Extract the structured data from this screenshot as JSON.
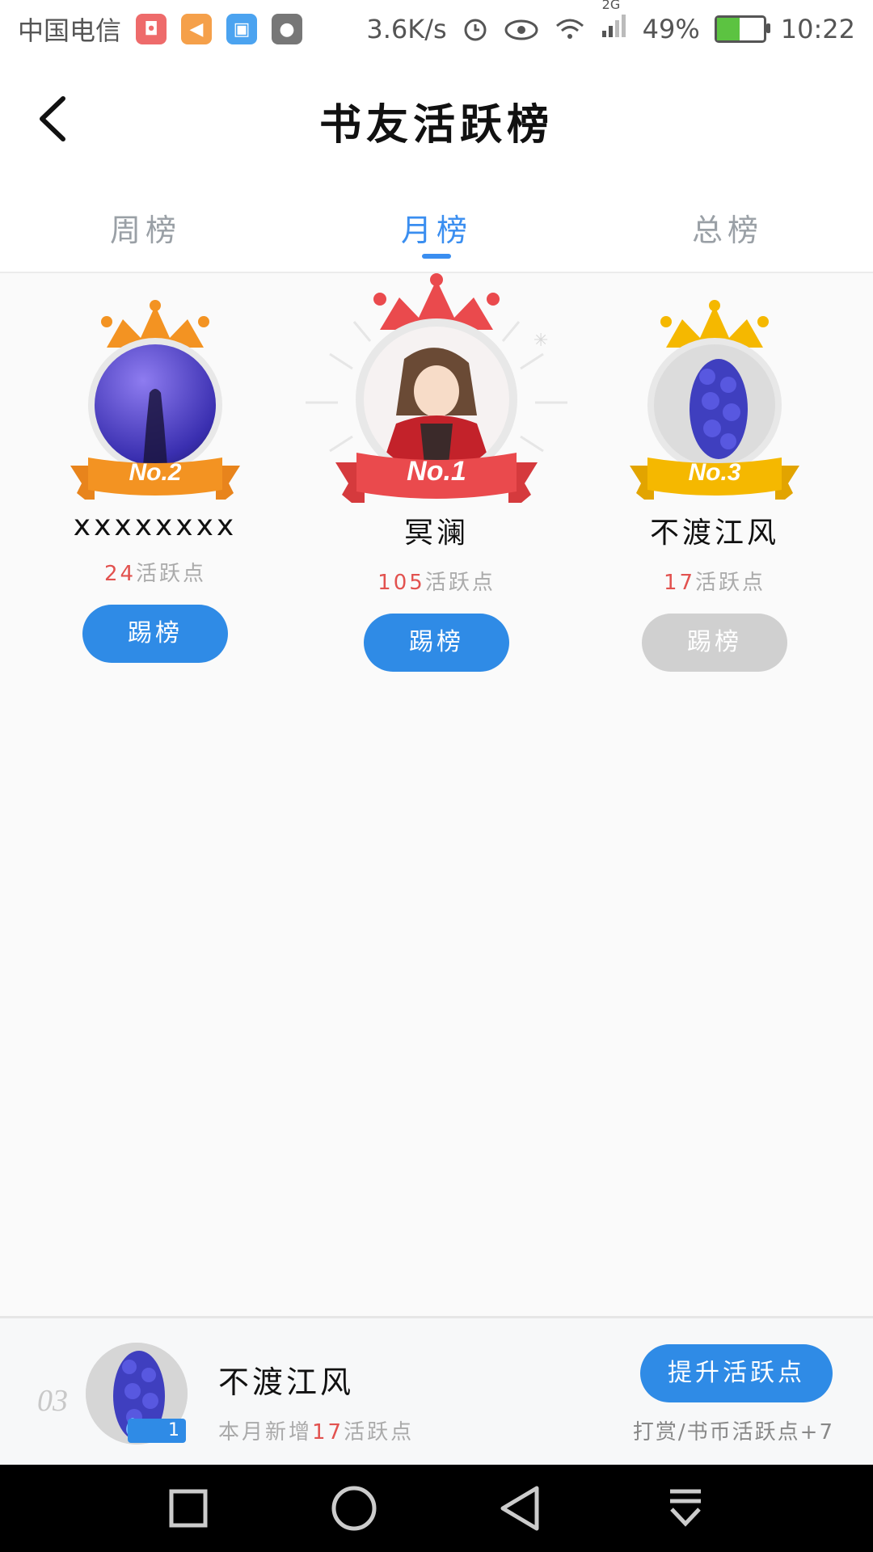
{
  "status_bar": {
    "carrier": "中国电信",
    "speed": "3.6K/s",
    "network": "2G",
    "battery": "49%",
    "battery_level": 0.49,
    "time": "10:22"
  },
  "header": {
    "title": "书友活跃榜"
  },
  "tabs": [
    {
      "label": "周榜",
      "active": false
    },
    {
      "label": "月榜",
      "active": true
    },
    {
      "label": "总榜",
      "active": false
    }
  ],
  "podium": {
    "first": {
      "rank_label": "No.1",
      "name": "冥澜",
      "points": "105",
      "points_suffix": "活跃点",
      "button": "踢榜",
      "button_enabled": true
    },
    "second": {
      "rank_label": "No.2",
      "name": "xxxxxxxx",
      "points": "24",
      "points_suffix": "活跃点",
      "button": "踢榜",
      "button_enabled": true
    },
    "third": {
      "rank_label": "No.3",
      "name": "不渡江风",
      "points": "17",
      "points_suffix": "活跃点",
      "button": "踢榜",
      "button_enabled": false
    }
  },
  "my_rank": {
    "rank": "03",
    "name": "不渡江风",
    "badge": "1",
    "sub_prefix": "本月新增",
    "sub_points": "17",
    "sub_suffix": "活跃点",
    "boost_button": "提升活跃点",
    "hint": "打赏/书币活跃点+7"
  },
  "colors": {
    "accent": "#3a8ef0",
    "button_blue": "#2f8be6",
    "button_disabled": "#d0d0d0",
    "points_red": "#e2524f",
    "gold": "#f5b800",
    "orange": "#f39322",
    "red": "#ea4a4d"
  }
}
